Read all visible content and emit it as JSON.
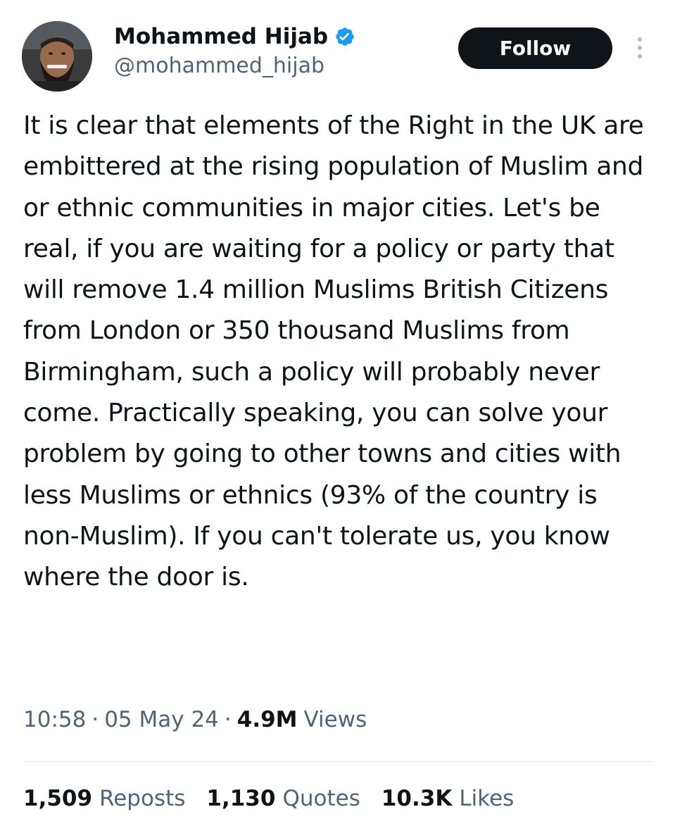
{
  "author": {
    "display_name": "Mohammed Hijab",
    "handle": "@mohammed_hijab",
    "verified_icon": "verified-badge-icon",
    "avatar_icon": "profile-photo"
  },
  "actions": {
    "follow_label": "Follow",
    "more_icon": "more-vertical-icon"
  },
  "tweet": {
    "text": "It is clear that elements of the Right in the UK are embittered at the rising population of Muslim and or ethnic communities in major cities. Let's be real, if you are waiting for a policy or party that will remove 1.4 million Muslims British Citizens from London or 350 thousand Muslims from Birmingham, such a policy will probably never come. Practically speaking, you can solve your problem by going to other towns and cities with less Muslims or ethnics (93% of the country is non-Muslim). If you can't tolerate us, you know where the door is."
  },
  "meta": {
    "time": "10:58",
    "separator": "·",
    "date": "05 May 24",
    "views_count": "4.9M",
    "views_label": "Views"
  },
  "stats": [
    {
      "count": "1,509",
      "label": "Reposts"
    },
    {
      "count": "1,130",
      "label": "Quotes"
    },
    {
      "count": "10.3K",
      "label": "Likes"
    }
  ],
  "colors": {
    "text_primary": "#0f1419",
    "text_secondary": "#536471",
    "verified_blue": "#1d9bf0",
    "button_bg": "#0f1419",
    "divider": "#e4e8eb"
  }
}
